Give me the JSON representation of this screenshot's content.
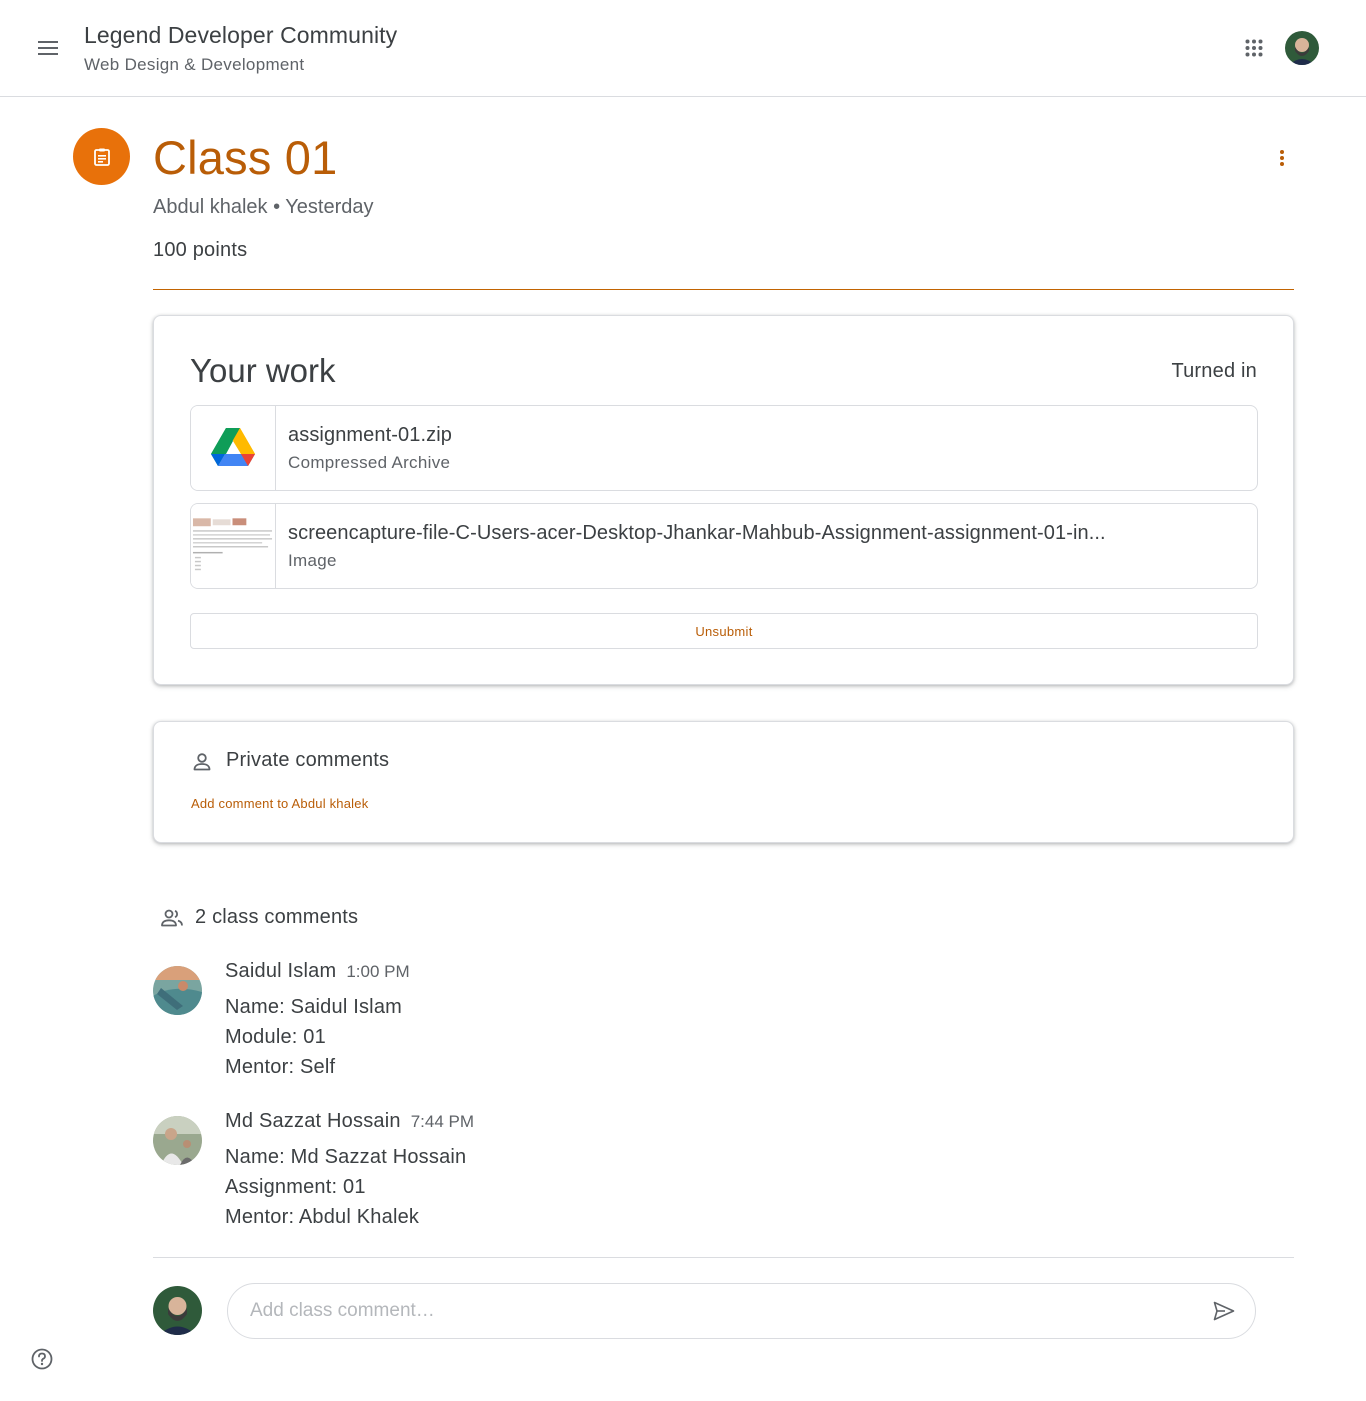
{
  "header": {
    "class_name": "Legend Developer Community",
    "section": "Web Design & Development",
    "menu_icon": "hamburger-menu-icon",
    "apps_icon": "google-apps-grid-icon"
  },
  "assignment": {
    "title": "Class 01",
    "meta": "Abdul khalek • Yesterday",
    "points": "100 points",
    "accent_color": "#e8710a",
    "title_color": "#b95d07"
  },
  "your_work": {
    "title": "Your work",
    "status": "Turned in",
    "attachments": [
      {
        "name": "assignment-01.zip",
        "type": "Compressed Archive",
        "icon": "google-drive-icon"
      },
      {
        "name": "screencapture-file-C-Users-acer-Desktop-Jhankar-Mahbub-Assignment-assignment-01-in...",
        "type": "Image",
        "icon": "image-thumbnail"
      }
    ],
    "unsubmit_label": "Unsubmit"
  },
  "private_comments": {
    "title": "Private comments",
    "add_link": "Add comment to Abdul khalek"
  },
  "class_comments": {
    "title": "2 class comments",
    "comments": [
      {
        "author": "Saidul Islam",
        "time": "1:00 PM",
        "lines": [
          "Name: Saidul Islam",
          "Module: 01",
          "Mentor: Self"
        ]
      },
      {
        "author": "Md Sazzat Hossain",
        "time": "7:44 PM",
        "lines": [
          "Name: Md Sazzat Hossain",
          "Assignment: 01",
          "Mentor: Abdul Khalek"
        ]
      }
    ],
    "input_placeholder": "Add class comment…"
  }
}
